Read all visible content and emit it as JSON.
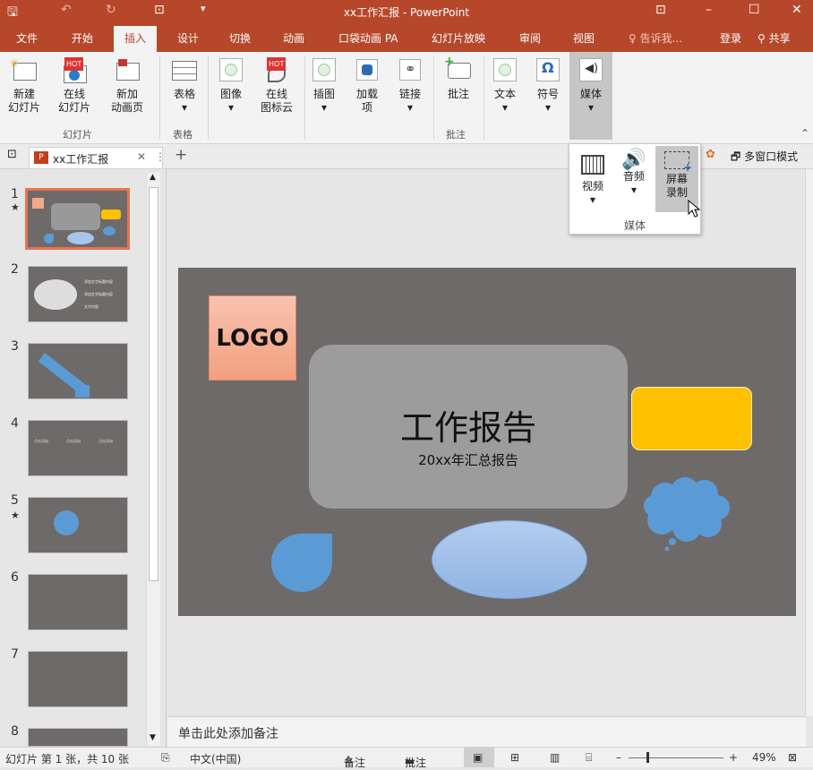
{
  "title": "xx工作汇报 - PowerPoint",
  "ribbon_tabs": [
    "文件",
    "开始",
    "插入",
    "设计",
    "切换",
    "动画",
    "口袋动画 PA",
    "幻灯片放映",
    "审阅",
    "视图",
    "告诉我...",
    "登录",
    "共享"
  ],
  "ribbon_tab_active": "插入",
  "ribbon": {
    "new_slide": "新建\n幻灯片",
    "online_slide": "在线\n幻灯片",
    "new_anim": "新加\n动画页",
    "group_slides": "幻灯片",
    "table": "表格",
    "group_table": "表格",
    "image": "图像",
    "icon_cloud": "在线\n图标云",
    "illustration": "插图",
    "addin": "加载\n项",
    "link": "链接",
    "comment": "批注",
    "group_comment": "批注",
    "text": "文本",
    "symbol": "符号",
    "media": "媒体",
    "hot": "HOT"
  },
  "media_popup": {
    "video": "视频",
    "audio": "音频",
    "screen_record": "屏幕\n录制",
    "group": "媒体"
  },
  "doc_tab": "xx工作汇报",
  "multi_window": "多窗口模式",
  "slides": [
    1,
    2,
    3,
    4,
    5,
    6,
    7,
    8
  ],
  "slide": {
    "logo": "LOGO",
    "title": "工作报告",
    "subtitle": "20xx年汇总报告"
  },
  "thumb_texts": {
    "t2a": "添加文字标题内容",
    "t2b": "添加文字标题内容",
    "t2c": "文字内容",
    "t4": "点击添加"
  },
  "notes_placeholder": "单击此处添加备注",
  "status": {
    "slide_info": "幻灯片 第 1 张，共 10 张",
    "language": "中文(中国)",
    "notes": "备注",
    "comments": "批注",
    "zoom": "49%"
  }
}
